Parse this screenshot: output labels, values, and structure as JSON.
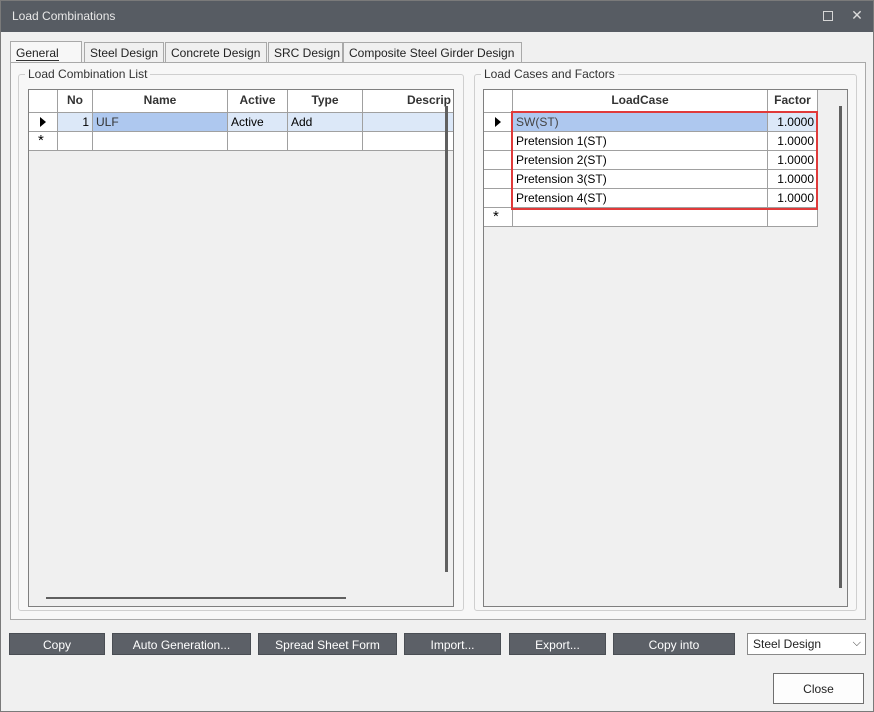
{
  "window": {
    "title": "Load Combinations"
  },
  "tabs": [
    {
      "label": "General"
    },
    {
      "label": "Steel Design"
    },
    {
      "label": "Concrete Design"
    },
    {
      "label": "SRC Design"
    },
    {
      "label": "Composite Steel Girder Design"
    }
  ],
  "combo_list": {
    "legend": "Load Combination List",
    "columns": [
      "No",
      "Name",
      "Active",
      "Type",
      "Descrip"
    ],
    "rows": [
      {
        "no": "1",
        "name": "ULF",
        "active": "Active",
        "type": "Add",
        "desc": ""
      }
    ],
    "new_row_marker": "*"
  },
  "load_cases": {
    "legend": "Load Cases and Factors",
    "columns": [
      "LoadCase",
      "Factor"
    ],
    "rows": [
      {
        "loadcase": "SW(ST)",
        "factor": "1.0000"
      },
      {
        "loadcase": "Pretension 1(ST)",
        "factor": "1.0000"
      },
      {
        "loadcase": "Pretension 2(ST)",
        "factor": "1.0000"
      },
      {
        "loadcase": "Pretension 3(ST)",
        "factor": "1.0000"
      },
      {
        "loadcase": "Pretension 4(ST)",
        "factor": "1.0000"
      }
    ],
    "new_row_marker": "*"
  },
  "buttons": {
    "copy": "Copy",
    "auto_generation": "Auto Generation...",
    "spread_sheet": "Spread Sheet Form",
    "import": "Import...",
    "export": "Export...",
    "copy_into": "Copy into",
    "close": "Close"
  },
  "design_select": {
    "value": "Steel Design"
  },
  "colors": {
    "titlebar": "#575c63",
    "button": "#5c6067",
    "selection": "#aec8ef",
    "highlight": "#e03a3a"
  }
}
